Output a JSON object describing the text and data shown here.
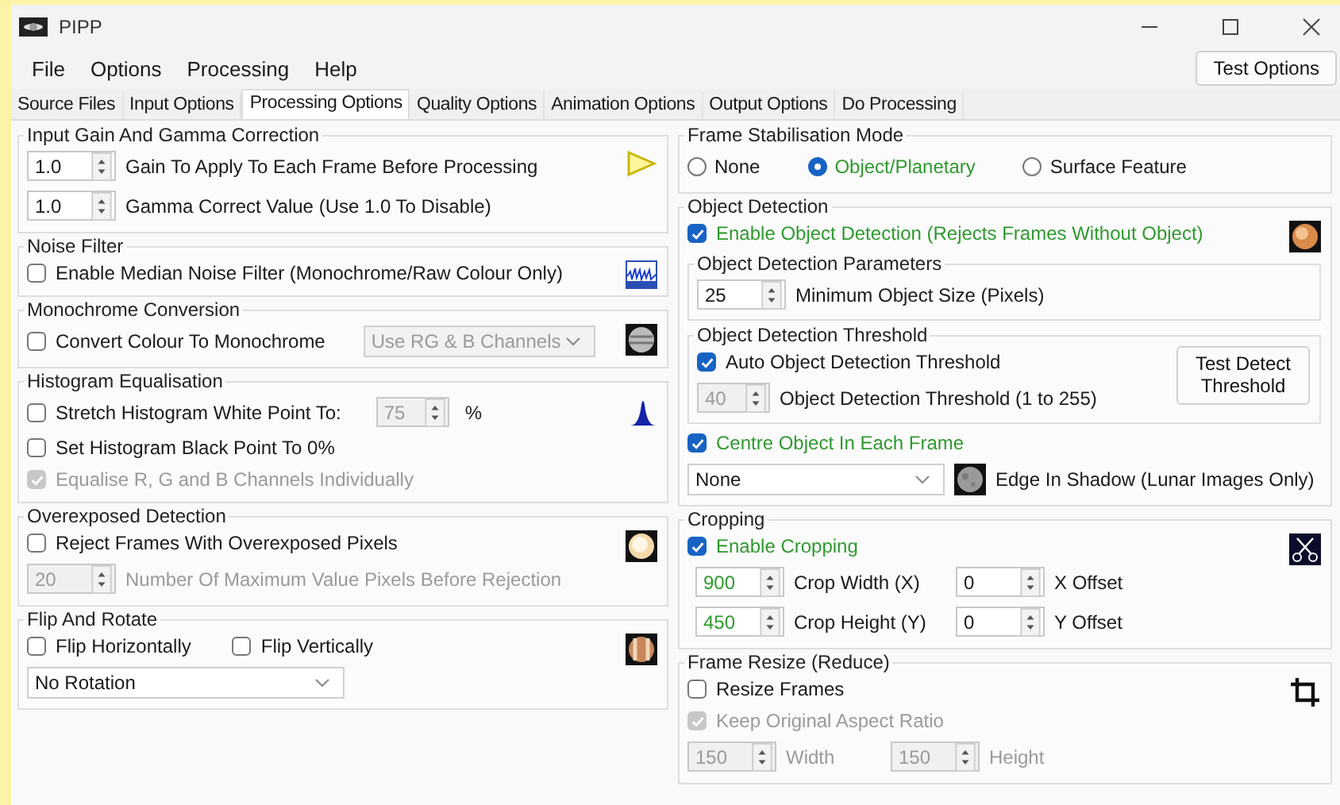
{
  "window": {
    "title": "PIPP"
  },
  "menu": [
    "File",
    "Options",
    "Processing",
    "Help"
  ],
  "test_options_button": "Test Options",
  "tabs": [
    {
      "label": "Source Files",
      "selected": false
    },
    {
      "label": "Input Options",
      "selected": false
    },
    {
      "label": "Processing Options",
      "selected": true
    },
    {
      "label": "Quality Options",
      "selected": false
    },
    {
      "label": "Animation Options",
      "selected": false
    },
    {
      "label": "Output Options",
      "selected": false
    },
    {
      "label": "Do Processing",
      "selected": false
    }
  ],
  "input_gain": {
    "title": "Input Gain And Gamma Correction",
    "gain": {
      "value": "1.0",
      "label": "Gain To Apply To Each Frame Before Processing"
    },
    "gamma": {
      "value": "1.0",
      "label": "Gamma Correct Value (Use 1.0 To Disable)"
    }
  },
  "noise_filter": {
    "title": "Noise Filter",
    "checkbox": {
      "label": "Enable Median Noise Filter (Monochrome/Raw Colour Only)",
      "checked": false
    }
  },
  "monochrome": {
    "title": "Monochrome Conversion",
    "checkbox": {
      "label": "Convert Colour To Monochrome",
      "checked": false
    },
    "dropdown": {
      "value": "Use RG & B Channels",
      "disabled": true
    }
  },
  "histogram": {
    "title": "Histogram Equalisation",
    "stretch": {
      "label": "Stretch Histogram White Point To:",
      "checked": false
    },
    "white_point": {
      "value": "75",
      "disabled": true
    },
    "unit": "%",
    "black_point": {
      "label": "Set Histogram Black Point To 0%",
      "checked": false
    },
    "equalise": {
      "label": "Equalise R, G and B Channels Individually",
      "checked": true,
      "disabled": true
    }
  },
  "overexposed": {
    "title": "Overexposed Detection",
    "reject": {
      "label": "Reject Frames With Overexposed Pixels",
      "checked": false
    },
    "max_pixels": {
      "value": "20",
      "label": "Number Of Maximum Value Pixels Before Rejection",
      "disabled": true
    }
  },
  "flip_rotate": {
    "title": "Flip And Rotate",
    "flip_h": {
      "label": "Flip Horizontally",
      "checked": false
    },
    "flip_v": {
      "label": "Flip Vertically",
      "checked": false
    },
    "rotation": {
      "value": "No Rotation"
    }
  },
  "stabilisation": {
    "title": "Frame Stabilisation Mode",
    "modes": [
      {
        "label": "None",
        "selected": false
      },
      {
        "label": "Object/Planetary",
        "selected": true
      },
      {
        "label": "Surface Feature",
        "selected": false
      }
    ]
  },
  "object_detection": {
    "title": "Object Detection",
    "enable": {
      "label": "Enable Object Detection (Rejects Frames Without Object)",
      "checked": true,
      "highlighted": true
    },
    "parameters": {
      "title": "Object Detection Parameters",
      "min_size": {
        "value": "25",
        "label": "Minimum Object Size (Pixels)"
      }
    },
    "threshold": {
      "title": "Object Detection Threshold",
      "auto": {
        "label": "Auto Object Detection Threshold",
        "checked": true,
        "highlighted": false
      },
      "value": {
        "value": "40",
        "label": "Object Detection Threshold (1 to 255)",
        "disabled": true
      },
      "test_button": "Test Detect Threshold"
    },
    "centre": {
      "label": "Centre Object In Each Frame",
      "checked": true,
      "highlighted": true
    },
    "edge_dropdown": {
      "value": "None"
    },
    "edge_label": "Edge In Shadow (Lunar Images Only)"
  },
  "cropping": {
    "title": "Cropping",
    "enable": {
      "label": "Enable Cropping",
      "checked": true,
      "highlighted": true
    },
    "width": {
      "value": "900",
      "label": "Crop Width (X)",
      "highlighted": true
    },
    "x_offset": {
      "value": "0",
      "label": "X Offset"
    },
    "height": {
      "value": "450",
      "label": "Crop Height (Y)",
      "highlighted": true
    },
    "y_offset": {
      "value": "0",
      "label": "Y Offset"
    }
  },
  "resize": {
    "title": "Frame Resize (Reduce)",
    "resize": {
      "label": "Resize Frames",
      "checked": false
    },
    "keep_aspect": {
      "label": "Keep Original Aspect Ratio",
      "checked": true,
      "disabled": true
    },
    "width": {
      "value": "150",
      "label": "Width",
      "disabled": true
    },
    "height": {
      "value": "150",
      "label": "Height",
      "disabled": true
    }
  }
}
